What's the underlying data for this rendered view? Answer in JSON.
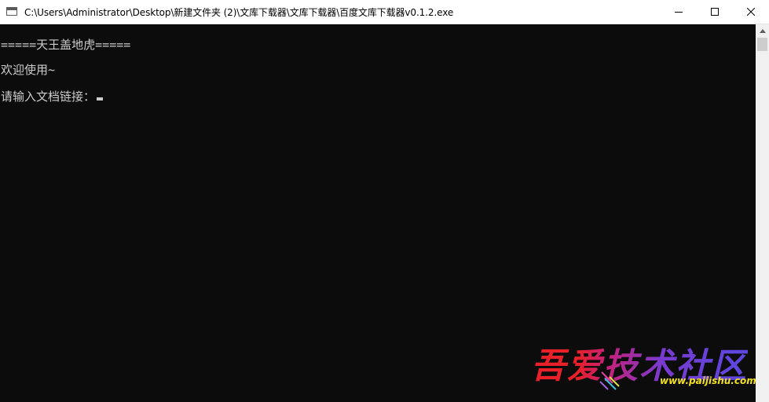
{
  "window": {
    "title": "C:\\Users\\Administrator\\Desktop\\新建文件夹 (2)\\文库下载器\\文库下载器\\百度文库下载器v0.1.2.exe",
    "controls": {
      "minimize": "minimize",
      "maximize": "maximize",
      "close": "close"
    }
  },
  "console": {
    "lines": [
      "=====天王盖地虎=====",
      "欢迎使用~",
      "请输入文档链接："
    ]
  },
  "watermark": {
    "logo": "吾爱技术社区",
    "url": "www.paijishu.com"
  },
  "colors": {
    "console_bg": "#0c0c0c",
    "console_text": "#cccccc",
    "titlebar_bg": "#ffffff",
    "watermark_red": "#e8202a",
    "watermark_purple": "#5a48e0",
    "watermark_url": "#f0e020"
  },
  "icons": {
    "app": "console-window-icon",
    "minimize": "minimize-icon",
    "maximize": "maximize-icon",
    "close": "close-icon",
    "scroll_up": "chevron-up-icon"
  }
}
